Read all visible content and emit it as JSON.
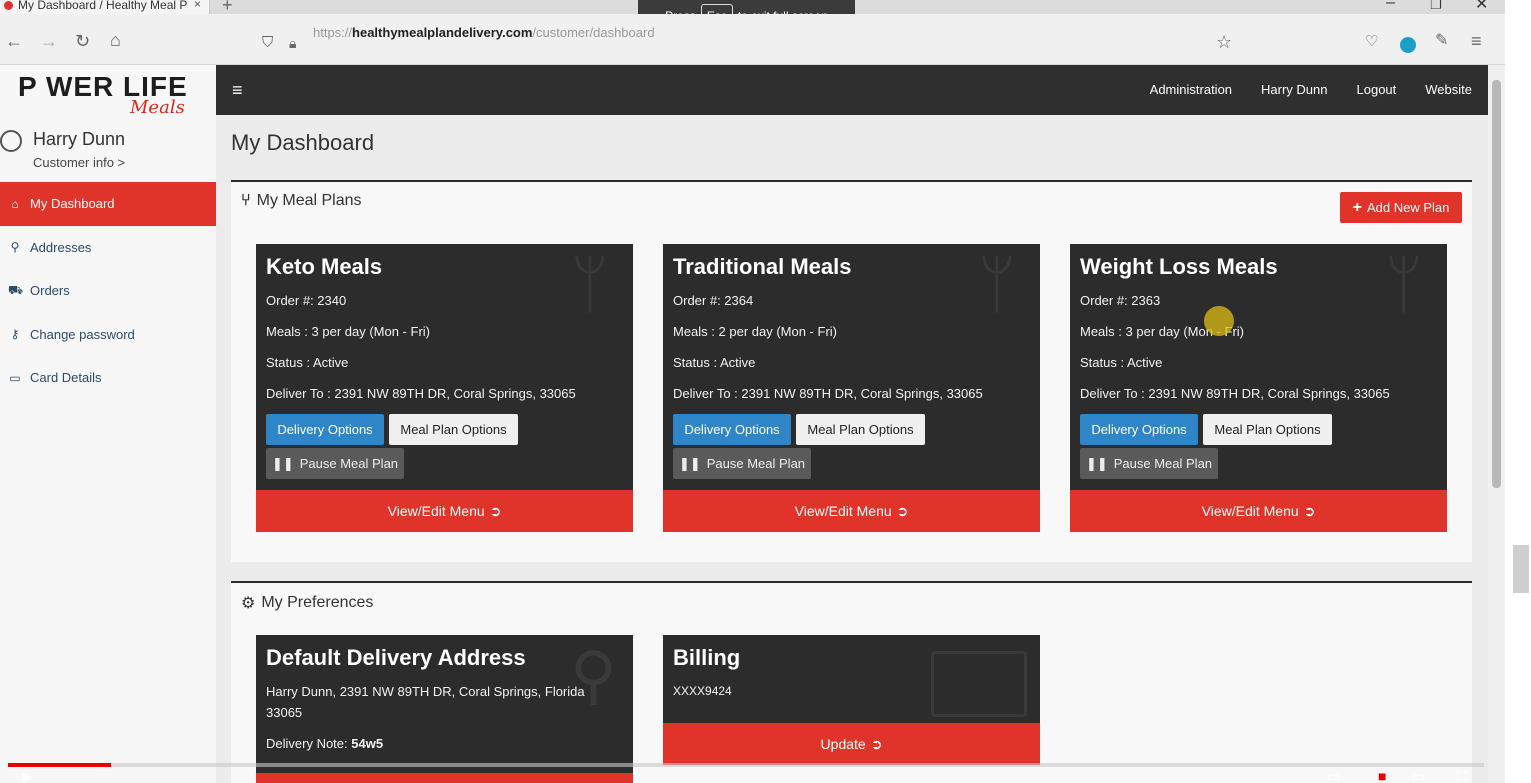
{
  "browser": {
    "tab_title": "My Dashboard / Healthy Meal P",
    "tab_close": "×",
    "new_tab": "+",
    "fullscreen_notice": {
      "press": "Press",
      "key": "Esc",
      "rest": "to exit full screen"
    },
    "url_prefix": "https://",
    "url_domain": "healthymealplandelivery.com",
    "url_path": "/customer/dashboard"
  },
  "logo": {
    "main": "P WER LIFE",
    "script": "Meals"
  },
  "user": {
    "name": "Harry Dunn",
    "customer_info": "Customer info >"
  },
  "sidebar": {
    "items": [
      {
        "label": "My Dashboard",
        "icon": "home-icon"
      },
      {
        "label": "Addresses",
        "icon": "map-marker-icon"
      },
      {
        "label": "Orders",
        "icon": "cart-icon"
      },
      {
        "label": "Change password",
        "icon": "key-icon"
      },
      {
        "label": "Card Details",
        "icon": "credit-card-icon"
      }
    ]
  },
  "topnav": {
    "administration": "Administration",
    "user": "Harry Dunn",
    "logout": "Logout",
    "website": "Website"
  },
  "page_title": "My Dashboard",
  "meal_plans": {
    "heading": "My Meal Plans",
    "add_button": "Add New Plan",
    "cards": [
      {
        "title": "Keto Meals",
        "order": "Order #: 2340",
        "meals": "Meals : 3 per day (Mon - Fri)",
        "status": "Status : Active",
        "deliver": "Deliver To : 2391 NW 89TH DR, Coral Springs, 33065",
        "delivery_btn": "Delivery Options",
        "plan_btn": "Meal Plan Options",
        "pause_btn": "Pause Meal Plan",
        "menu_btn": "View/Edit Menu"
      },
      {
        "title": "Traditional Meals",
        "order": "Order #: 2364",
        "meals": "Meals : 2 per day (Mon - Fri)",
        "status": "Status : Active",
        "deliver": "Deliver To : 2391 NW 89TH DR, Coral Springs, 33065",
        "delivery_btn": "Delivery Options",
        "plan_btn": "Meal Plan Options",
        "pause_btn": "Pause Meal Plan",
        "menu_btn": "View/Edit Menu"
      },
      {
        "title": "Weight Loss Meals",
        "order": "Order #: 2363",
        "meals": "Meals : 3 per day (Mon - Fri)",
        "status": "Status : Active",
        "deliver": "Deliver To : 2391 NW 89TH DR, Coral Springs, 33065",
        "delivery_btn": "Delivery Options",
        "plan_btn": "Meal Plan Options",
        "pause_btn": "Pause Meal Plan",
        "menu_btn": "View/Edit Menu"
      }
    ]
  },
  "preferences": {
    "heading": "My Preferences",
    "address": {
      "title": "Default Delivery Address",
      "line1": "Harry Dunn, 2391 NW 89TH DR, Coral Springs, Florida",
      "line2": "33065",
      "note_label": "Delivery Note:",
      "note_value": "54w5"
    },
    "billing": {
      "title": "Billing",
      "card": "XXXX9424",
      "update_btn": "Update"
    }
  },
  "video": {
    "progress": 0.07
  }
}
